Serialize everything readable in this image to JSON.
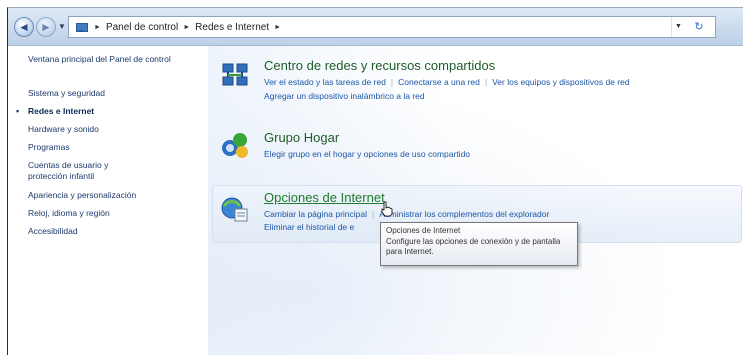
{
  "window": {
    "breadcrumbs": [
      "Panel de control",
      "Redes e Internet"
    ]
  },
  "sidebar": {
    "items": [
      {
        "label": "Ventana principal del Panel de control",
        "active": false
      },
      {
        "label": "Sistema y seguridad",
        "active": false
      },
      {
        "label": "Redes e Internet",
        "active": true
      },
      {
        "label": "Hardware y sonido",
        "active": false
      },
      {
        "label": "Programas",
        "active": false
      },
      {
        "label": "Cuentas de usuario y protección infantil",
        "active": false
      },
      {
        "label": "Apariencia y personalización",
        "active": false
      },
      {
        "label": "Reloj, idioma y región",
        "active": false
      },
      {
        "label": "Accesibilidad",
        "active": false
      }
    ]
  },
  "categories": [
    {
      "title": "Centro de redes y recursos compartidos",
      "icon": "network-center-icon",
      "tasks_row1": [
        "Ver el estado y las tareas de red",
        "Conectarse a una red",
        "Ver los equipos y dispositivos de red"
      ],
      "tasks_row2": [
        "Agregar un dispositivo inalámbrico a la red"
      ]
    },
    {
      "title": "Grupo Hogar",
      "icon": "homegroup-icon",
      "tasks_row1": [
        "Elegir grupo en el hogar y opciones de uso compartido"
      ]
    },
    {
      "title": "Opciones de Internet",
      "icon": "internet-options-icon",
      "tasks_row1": [
        "Cambiar la página principal",
        "Administrar los complementos del explorador"
      ],
      "tasks_row2": [
        "Eliminar el historial de e"
      ]
    }
  ],
  "tooltip": {
    "title": "Opciones de Internet",
    "text": "Configure las opciones de conexión y de pantalla para Internet."
  },
  "colors": {
    "link": "#1c56a8",
    "category_title": "#1e5c2a",
    "sidebar_text": "#1d3a6b"
  }
}
